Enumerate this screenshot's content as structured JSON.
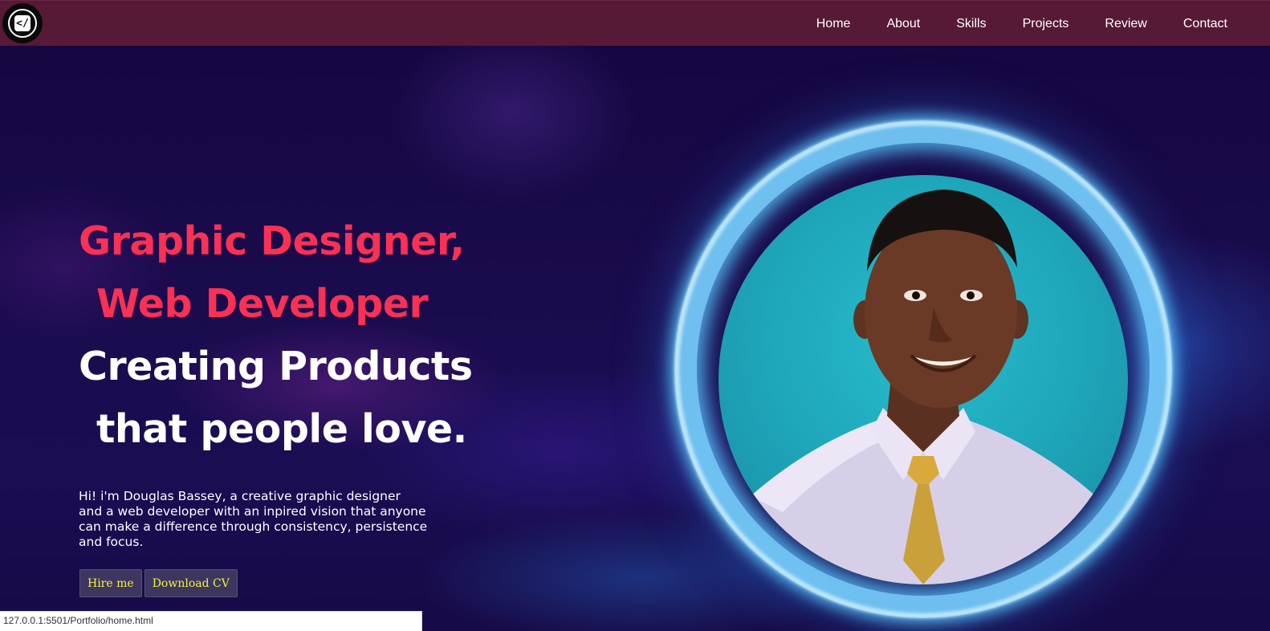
{
  "nav": {
    "logo_icon": "code-brackets-logo",
    "links": [
      "Home",
      "About",
      "Skills",
      "Projects",
      "Review",
      "Contact"
    ]
  },
  "hero": {
    "headline_line1": "Graphic Designer,",
    "headline_line2": "Web Developer",
    "headline_line3": "Creating Products",
    "headline_line4": "that people love.",
    "intro_line1": "Hi! i'm Douglas Bassey, a creative graphic designer",
    "intro_line2": "and a web developer with an inpired vision that anyone",
    "intro_line3": "can make a difference through consistency, persistence",
    "intro_line4": "and focus.",
    "hire_button": "Hire me",
    "cv_button": "Download CV"
  },
  "portrait": {
    "icon": "profile-photo",
    "ring_color": "#78d2ff"
  },
  "status_bar": {
    "url": "127.0.0.1:5501/Portfolio/home.html"
  },
  "colors": {
    "accent": "#fb3055",
    "nav_bg": "#561a36",
    "button_text": "#f2f239"
  }
}
